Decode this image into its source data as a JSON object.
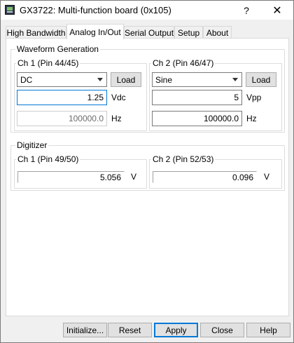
{
  "window": {
    "title": "GX3722: Multi-function board (0x105)",
    "help_label": "?",
    "close_label": "✕"
  },
  "tabs": [
    "High Bandwidth",
    "Analog In/Out",
    "Serial Output",
    "Setup",
    "About"
  ],
  "active_tab": "Analog In/Out",
  "waveform": {
    "title": "Waveform Generation",
    "ch1": {
      "title": "Ch 1 (Pin 44/45)",
      "waveform": "DC",
      "load_label": "Load",
      "amplitude": "1.25",
      "amplitude_unit": "Vdc",
      "frequency": "100000.0",
      "frequency_unit": "Hz"
    },
    "ch2": {
      "title": "Ch 2 (Pin 46/47)",
      "waveform": "Sine",
      "load_label": "Load",
      "amplitude": "5",
      "amplitude_unit": "Vpp",
      "frequency": "100000.0",
      "frequency_unit": "Hz"
    }
  },
  "digitizer": {
    "title": "Digitizer",
    "ch1": {
      "title": "Ch 1 (Pin 49/50)",
      "value": "5.056",
      "unit": "V"
    },
    "ch2": {
      "title": "Ch 2 (Pin 52/53)",
      "value": "0.096",
      "unit": "V"
    }
  },
  "buttons": {
    "initialize": "Initialize...",
    "reset": "Reset",
    "apply": "Apply",
    "close": "Close",
    "help": "Help"
  },
  "colors": {
    "focus_border": "#0078d7",
    "dialog_bg": "#f0f0f0"
  }
}
